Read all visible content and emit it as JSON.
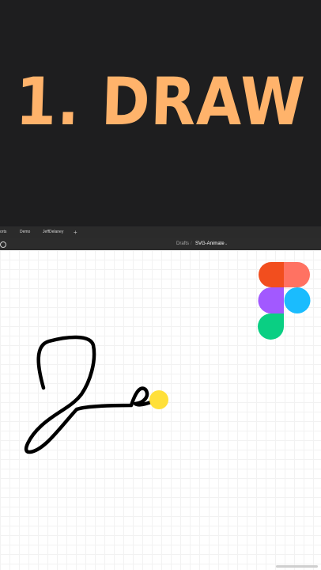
{
  "hero": {
    "title": "1. DRAW"
  },
  "tabs": [
    {
      "label": "orts"
    },
    {
      "label": "Demo"
    },
    {
      "label": "JeffDelaney"
    }
  ],
  "tab_add": "+",
  "breadcrumb": {
    "parent": "Drafts",
    "separator": "/",
    "current": "SVG-Animate",
    "chevron": "⌄"
  },
  "colors": {
    "hero_bg": "#1e1e1f",
    "hero_text": "#ffb36b",
    "cursor_dot": "#ffe03a",
    "stroke": "#000000",
    "figma_red": "#f24e1e",
    "figma_salmon": "#ff7262",
    "figma_purple": "#a259ff",
    "figma_blue": "#1abcfe",
    "figma_green": "#0acf83"
  },
  "icons": [
    "search-icon",
    "figma-logo-icon"
  ]
}
